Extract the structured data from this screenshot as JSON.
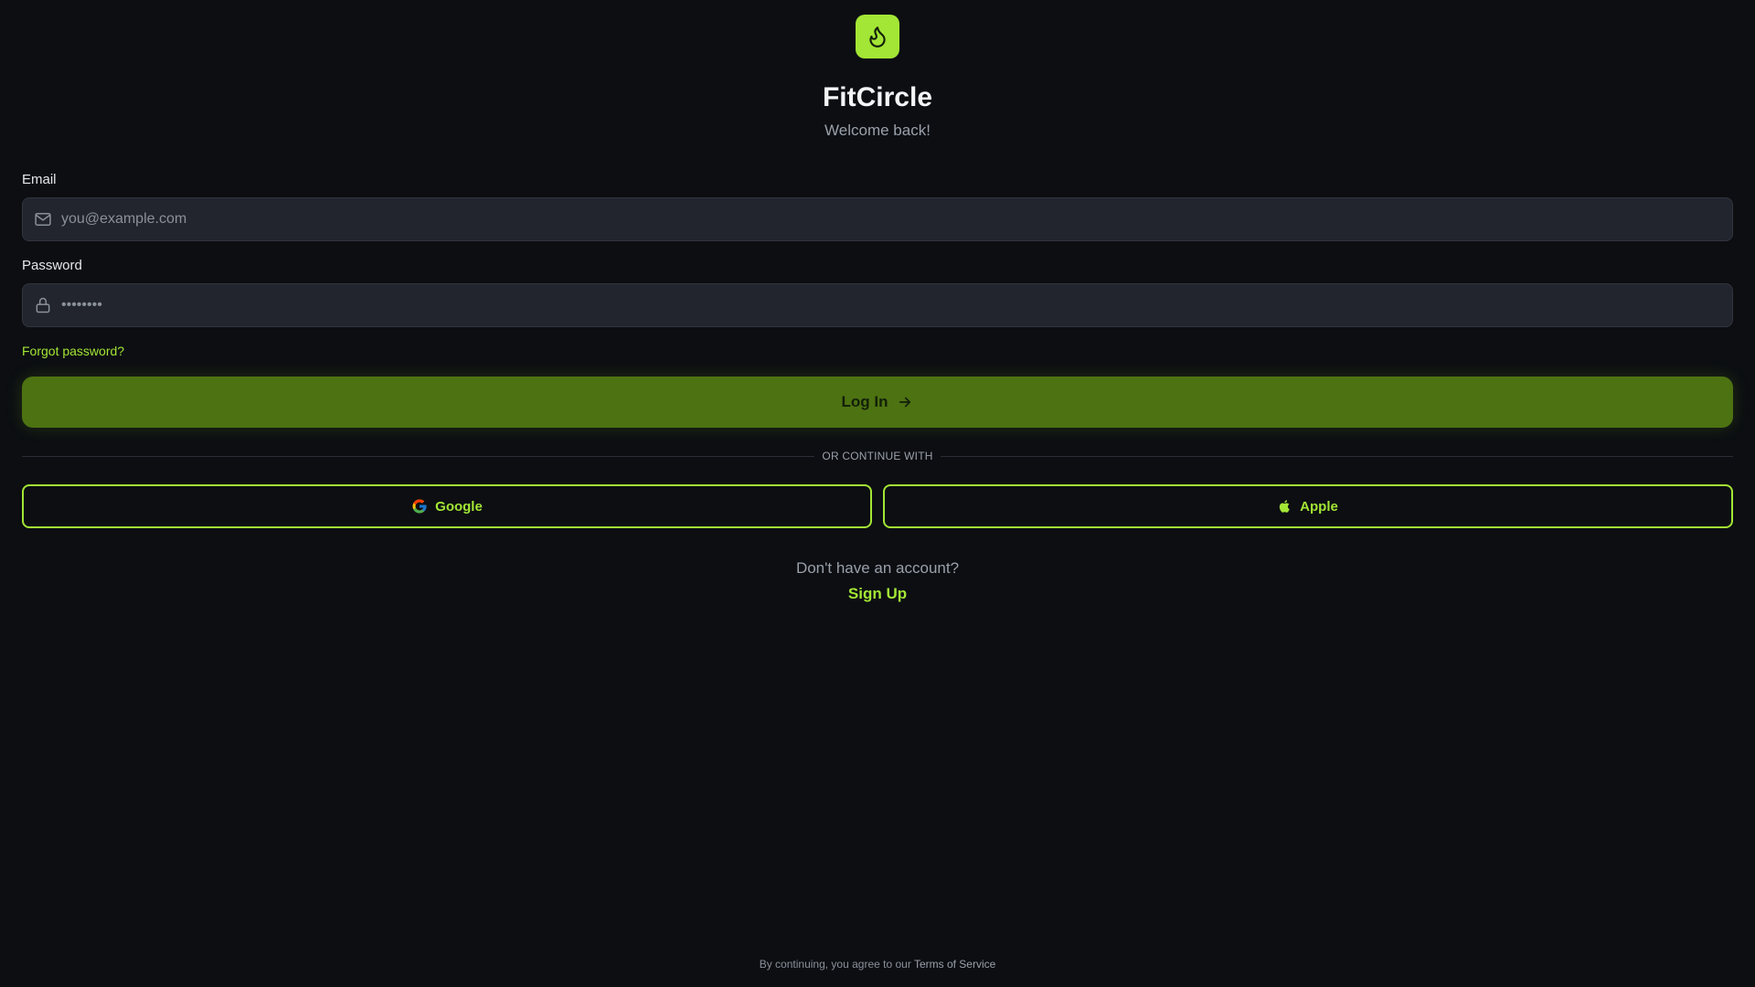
{
  "brand": {
    "name": "FitCircle",
    "subtitle": "Welcome back!",
    "logo_icon": "flame-icon",
    "accent_color": "#a3e635"
  },
  "form": {
    "email": {
      "label": "Email",
      "placeholder": "you@example.com",
      "value": "",
      "icon": "mail-icon"
    },
    "password": {
      "label": "Password",
      "placeholder": "••••••••",
      "value": "",
      "icon": "lock-icon"
    },
    "forgot_label": "Forgot password?",
    "login_label": "Log In",
    "login_icon": "arrow-right-icon"
  },
  "divider": {
    "text": "OR CONTINUE WITH"
  },
  "social": {
    "google_label": "Google",
    "apple_label": "Apple"
  },
  "signup": {
    "prompt": "Don't have an account?",
    "link_label": "Sign Up"
  },
  "footer": {
    "prefix": "By continuing, you agree to our ",
    "terms_label": "Terms of Service"
  }
}
